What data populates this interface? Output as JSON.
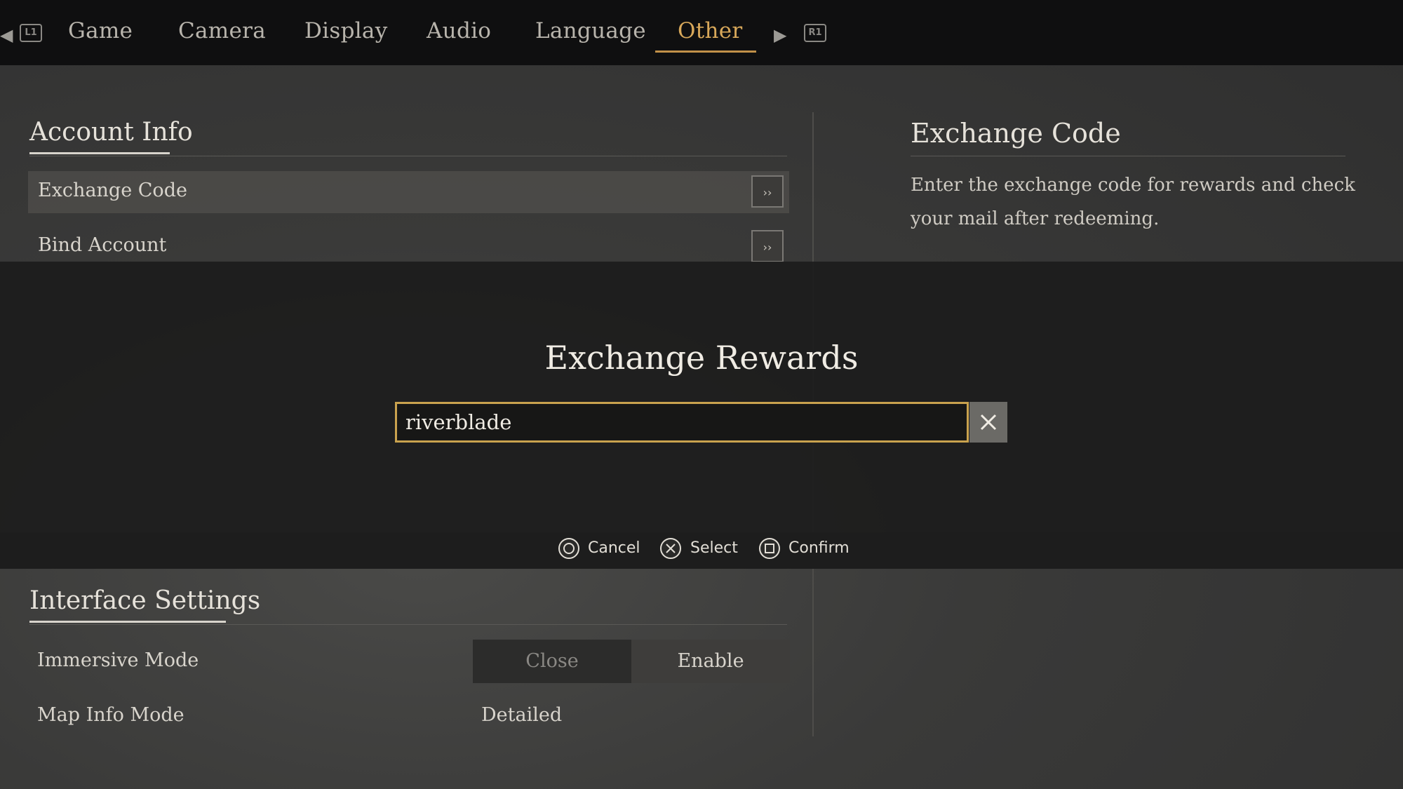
{
  "nav": {
    "tabs": [
      "Game",
      "Camera",
      "Display",
      "Audio",
      "Language",
      "Other"
    ],
    "active_index": 5,
    "prev_button": "L1",
    "next_button": "R1"
  },
  "account": {
    "title": "Account Info",
    "items": [
      {
        "label": "Exchange Code"
      },
      {
        "label": "Bind Account"
      }
    ]
  },
  "detail": {
    "title": "Exchange Code",
    "description": "Enter the exchange code for rewards and check your mail after redeeming."
  },
  "interface": {
    "title": "Interface Settings",
    "immersive_label": "Immersive Mode",
    "immersive_options": [
      "Close",
      "Enable"
    ],
    "map_info_label": "Map Info Mode",
    "map_info_value": "Detailed"
  },
  "modal": {
    "title": "Exchange Rewards",
    "input_value": "riverblade"
  },
  "hints": {
    "cancel": "Cancel",
    "select": "Select",
    "confirm": "Confirm"
  },
  "colors": {
    "accent": "#d8a85a",
    "input_border": "#c9a24e"
  }
}
